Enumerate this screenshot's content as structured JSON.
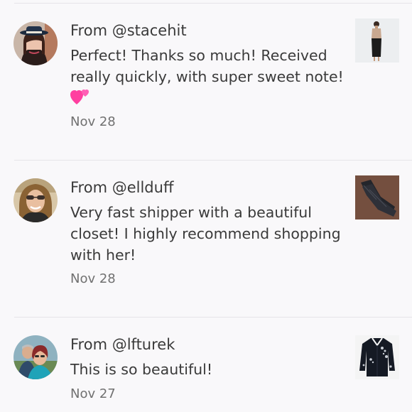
{
  "comments": [
    {
      "author_prefix": "From ",
      "username": "@stacehit",
      "text": "Perfect! Thanks so much! Received really quickly, with super sweet note!",
      "emoji": "two-hearts-icon",
      "date": "Nov 28",
      "avatar_icon": "user-avatar-stacehit",
      "thumbnail_icon": "listing-thumbnail-black-skirt"
    },
    {
      "author_prefix": "From ",
      "username": "@ellduff",
      "text": "Very fast shipper with a beautiful closet! I highly recommend shopping with her!",
      "date": "Nov 28",
      "avatar_icon": "user-avatar-ellduff",
      "thumbnail_icon": "listing-thumbnail-jeans"
    },
    {
      "author_prefix": "From ",
      "username": "@lfturek",
      "text": "This is so beautiful!",
      "date": "Nov 27",
      "avatar_icon": "user-avatar-lfturek",
      "thumbnail_icon": "listing-thumbnail-embellished-cardigan"
    }
  ],
  "colors": {
    "background": "#f9f8fa",
    "text": "#3a3a3a",
    "date": "#707070",
    "divider": "#e6e4e8",
    "heart": "#ff3fa0"
  }
}
